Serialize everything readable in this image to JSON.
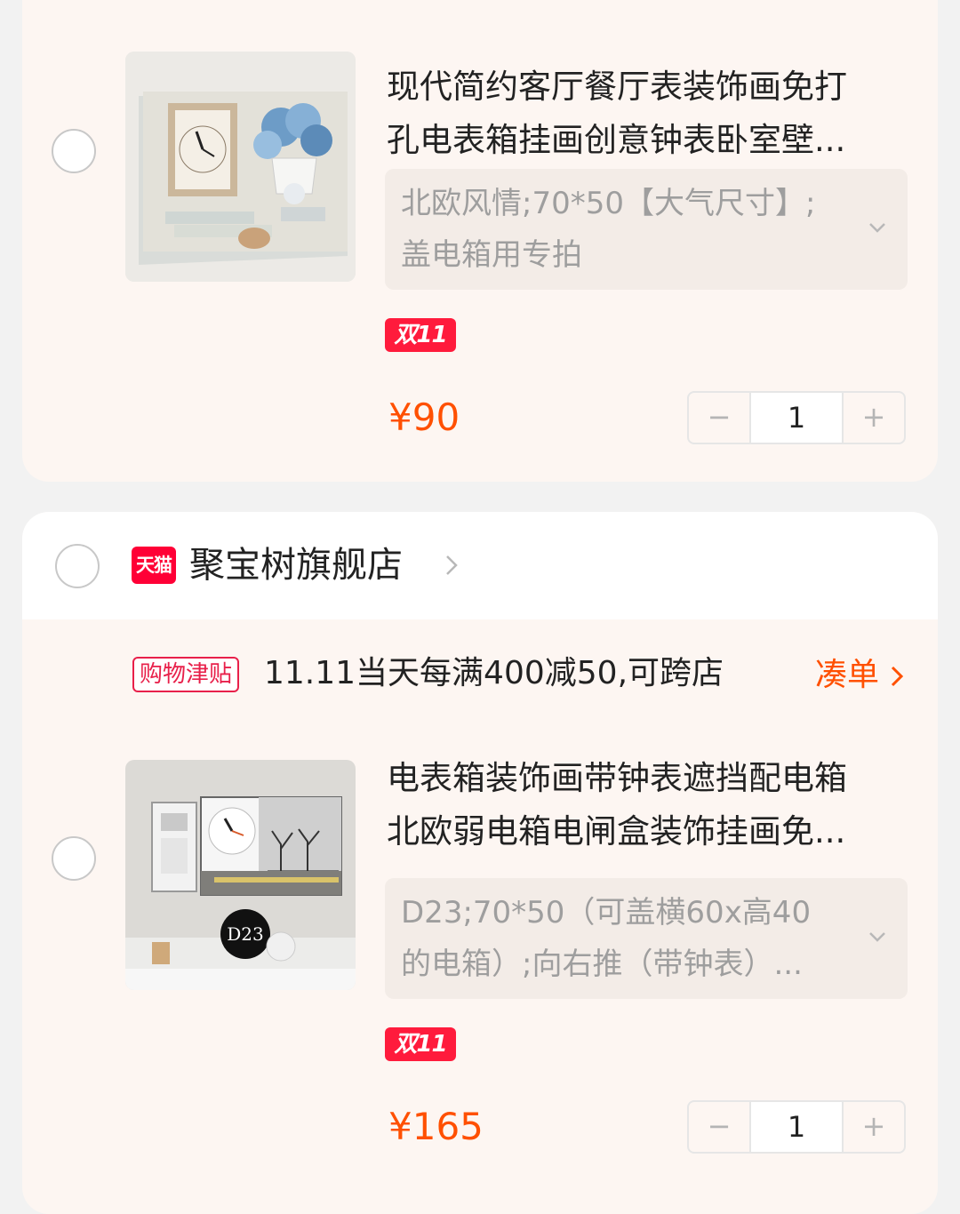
{
  "items": [
    {
      "title_line1": "现代简约客厅餐厅表装饰画免打",
      "title_line2": "孔电表箱挂画创意钟表卧室壁...",
      "sku_line1": "北欧风情;70*50【大气尺寸】;",
      "sku_line2": "盖电箱用专拍",
      "badge": "双11",
      "price": "¥90",
      "quantity": "1"
    },
    {
      "title_line1": "电表箱装饰画带钟表遮挡配电箱",
      "title_line2": "北欧弱电箱电闸盒装饰挂画免...",
      "sku_line1": "D23;70*50（可盖横60x高40",
      "sku_line2": "的电箱）;向右推（带钟表）...",
      "badge": "双11",
      "price": "¥165",
      "quantity": "1",
      "image_label": "D23"
    }
  ],
  "store": {
    "badge": "天猫",
    "name": "聚宝树旗舰店"
  },
  "promo": {
    "tag": "购物津贴",
    "text": "11.11当天每满400减50,可跨店",
    "link": "凑单"
  },
  "stepper": {
    "minus": "−",
    "plus": "+"
  },
  "colors": {
    "accent": "#ff5000",
    "tmall_red": "#ff0036",
    "card_bg": "#fdf6f2"
  }
}
